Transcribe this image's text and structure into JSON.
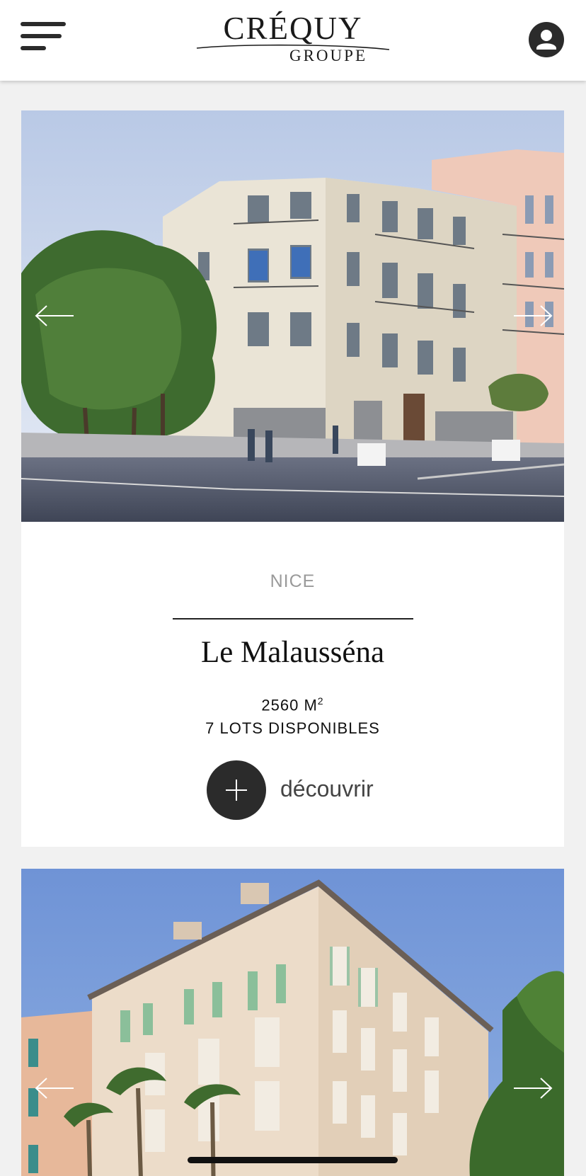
{
  "header": {
    "logo_main": "CRÉQUY",
    "logo_sub": "GROUPE"
  },
  "listings": [
    {
      "city": "NICE",
      "name": "Le Malausséna",
      "area_value": "2560 M",
      "area_unit_sup": "2",
      "lots": "7 LOTS DISPONIBLES",
      "cta_label": "découvrir"
    }
  ],
  "colors": {
    "brand_dark": "#2b2b2b",
    "background": "#f1f1f1",
    "card": "#ffffff",
    "muted_text": "#9a9a9a"
  },
  "icons": {
    "menu": "hamburger-icon",
    "account": "user-icon",
    "prev": "arrow-left-icon",
    "next": "arrow-right-icon",
    "add": "plus-icon"
  }
}
